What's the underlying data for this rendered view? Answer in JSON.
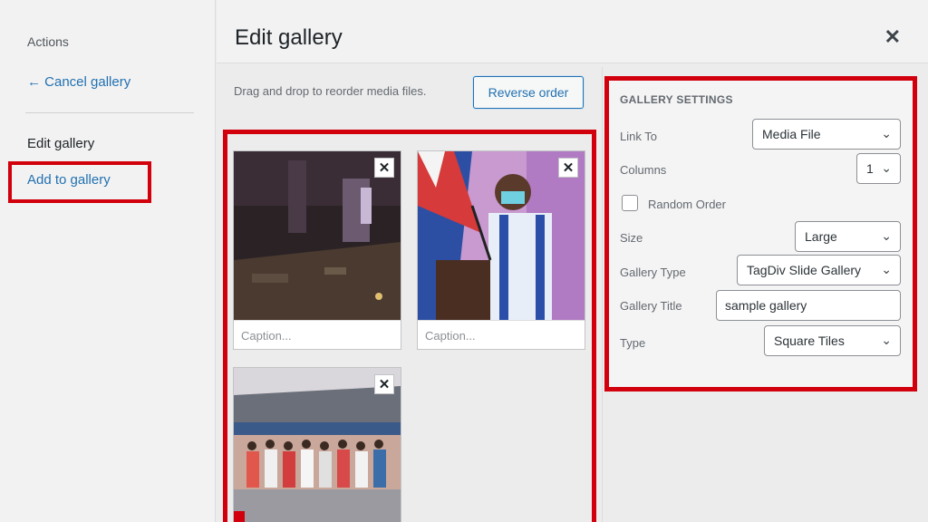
{
  "sidebar": {
    "actions_label": "Actions",
    "cancel_label": "← Cancel gallery",
    "edit_label": "Edit gallery",
    "add_label": "Add to gallery"
  },
  "header": {
    "title": "Edit gallery",
    "close_glyph": "✕"
  },
  "toolbar": {
    "hint": "Drag and drop to reorder media files.",
    "reverse_label": "Reverse order"
  },
  "media": {
    "items": [
      {
        "caption_placeholder": "Caption...",
        "remove_glyph": "✕"
      },
      {
        "caption_placeholder": "Caption...",
        "remove_glyph": "✕"
      },
      {
        "remove_glyph": "✕"
      }
    ]
  },
  "settings": {
    "title": "GALLERY SETTINGS",
    "link_to": {
      "label": "Link To",
      "value": "Media File"
    },
    "columns": {
      "label": "Columns",
      "value": "1"
    },
    "random_order": {
      "label": "Random Order",
      "checked": false
    },
    "size": {
      "label": "Size",
      "value": "Large"
    },
    "gallery_type": {
      "label": "Gallery Type",
      "value": "TagDiv Slide Gallery"
    },
    "gallery_title": {
      "label": "Gallery Title",
      "value": "sample gallery"
    },
    "type": {
      "label": "Type",
      "value": "Square Tiles"
    },
    "chevron_glyph": "⌄"
  },
  "colors": {
    "highlight": "#d2000d",
    "link": "#2271b1"
  }
}
